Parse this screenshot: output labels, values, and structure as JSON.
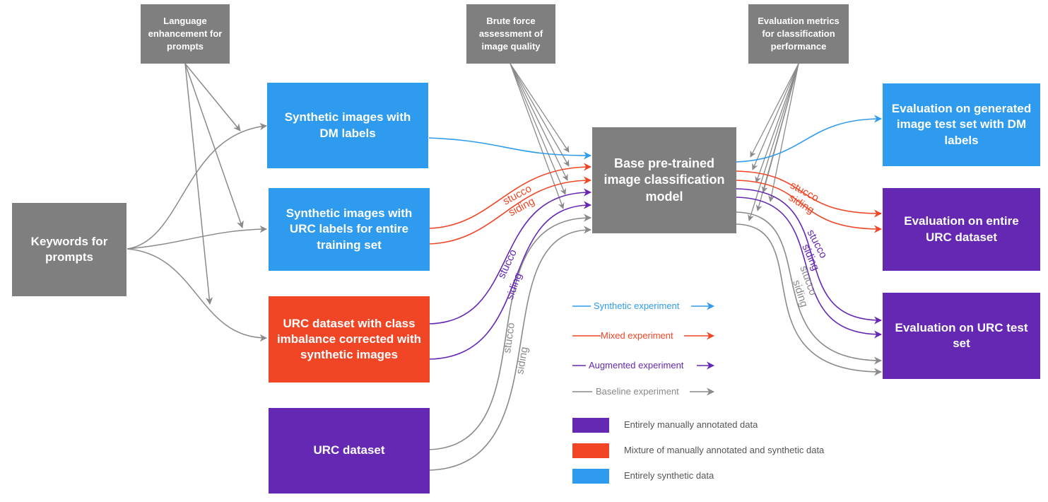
{
  "colors": {
    "gray": "#7f7f7f",
    "blue": "#2e9bee",
    "red": "#f04626",
    "purple": "#6528b2",
    "arrow_gray": "#8a8a8a"
  },
  "top_boxes": {
    "language": "Language enhancement for prompts",
    "brute_force": "Brute force assessment of image quality",
    "metrics": "Evaluation metrics for classification performance"
  },
  "keywords": "Keywords for prompts",
  "inputs": {
    "synthetic_dm": "Synthetic images with DM labels",
    "synthetic_urc": "Synthetic images with URC labels for entire training set",
    "urc_balanced": "URC dataset with class imbalance corrected with synthetic images",
    "urc": "URC dataset"
  },
  "model": "Base pre-trained image classification model",
  "outputs": {
    "eval_generated": "Evaluation on generated image test set with DM labels",
    "eval_entire": "Evaluation on entire URC dataset",
    "eval_test": "Evaluation on URC test set"
  },
  "edge_labels": {
    "stucco": "stucco",
    "siding": "siding"
  },
  "legend": {
    "experiments": [
      {
        "label": "Synthetic experiment",
        "color": "#2e9bee"
      },
      {
        "label": "Mixed experiment",
        "color": "#f04626"
      },
      {
        "label": "Augmented experiment",
        "color": "#6528b2"
      },
      {
        "label": "Baseline experiment",
        "color": "#8a8a8a"
      }
    ],
    "data_types": [
      {
        "label": "Entirely manually annotated data",
        "color": "#6528b2"
      },
      {
        "label": "Mixture of manually annotated and synthetic data",
        "color": "#f04626"
      },
      {
        "label": "Entirely synthetic data",
        "color": "#2e9bee"
      }
    ]
  }
}
